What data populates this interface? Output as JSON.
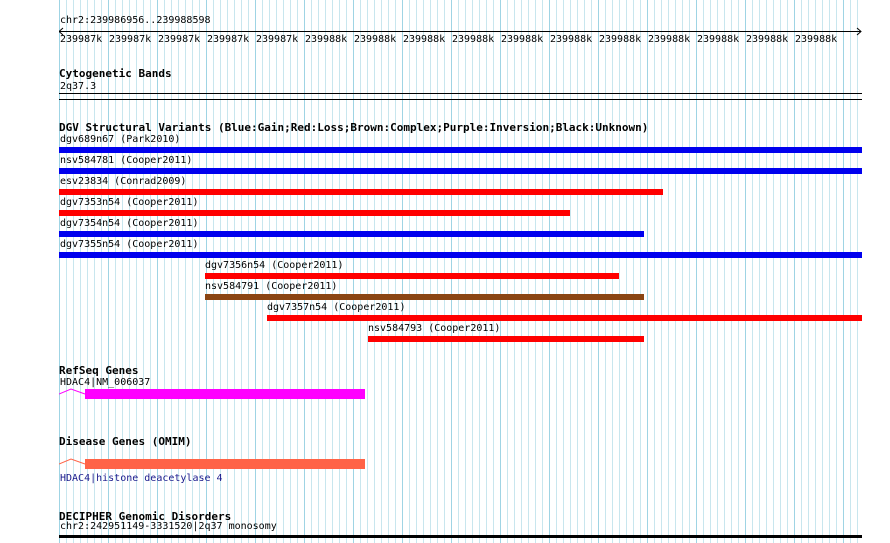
{
  "ruler": {
    "location": "chr2:239986956..239988598",
    "tick_labels": [
      "239987k",
      "239987k",
      "239987k",
      "239987k",
      "239987k",
      "239988k",
      "239988k",
      "239988k",
      "239988k",
      "239988k",
      "239988k",
      "239988k",
      "239988k",
      "239988k",
      "239988k",
      "239988k"
    ]
  },
  "cytobands": {
    "title": "Cytogenetic Bands",
    "band": "2q37.3"
  },
  "dgv": {
    "title": "DGV Structural Variants (Blue:Gain;Red:Loss;Brown:Complex;Purple:Inversion;Black:Unknown)",
    "colors": {
      "gain": "#0000ee",
      "loss": "#ff0000",
      "complex": "#8b4513"
    },
    "variants": [
      {
        "label": "dgv689n67 (Park2010)",
        "type": "gain"
      },
      {
        "label": "nsv584781 (Cooper2011)",
        "type": "gain"
      },
      {
        "label": "esv23834 (Conrad2009)",
        "type": "loss"
      },
      {
        "label": "dgv7353n54 (Cooper2011)",
        "type": "loss"
      },
      {
        "label": "dgv7354n54 (Cooper2011)",
        "type": "gain"
      },
      {
        "label": "dgv7355n54 (Cooper2011)",
        "type": "gain"
      },
      {
        "label": "dgv7356n54 (Cooper2011)",
        "type": "loss"
      },
      {
        "label": "nsv584791 (Cooper2011)",
        "type": "complex"
      },
      {
        "label": "dgv7357n54 (Cooper2011)",
        "type": "loss"
      },
      {
        "label": "nsv584793 (Cooper2011)",
        "type": "loss"
      }
    ]
  },
  "refseq": {
    "title": "RefSeq Genes",
    "gene_label": "HDAC4|NM_006037",
    "color": "#ff00ff"
  },
  "omim": {
    "title": "Disease Genes (OMIM)",
    "gene_label": "HDAC4|histone deacetylase 4",
    "color": "#ff6347"
  },
  "decipher": {
    "title": "DECIPHER Genomic Disorders",
    "label": "chr2:242951149-3331520|2q37 monosomy"
  }
}
